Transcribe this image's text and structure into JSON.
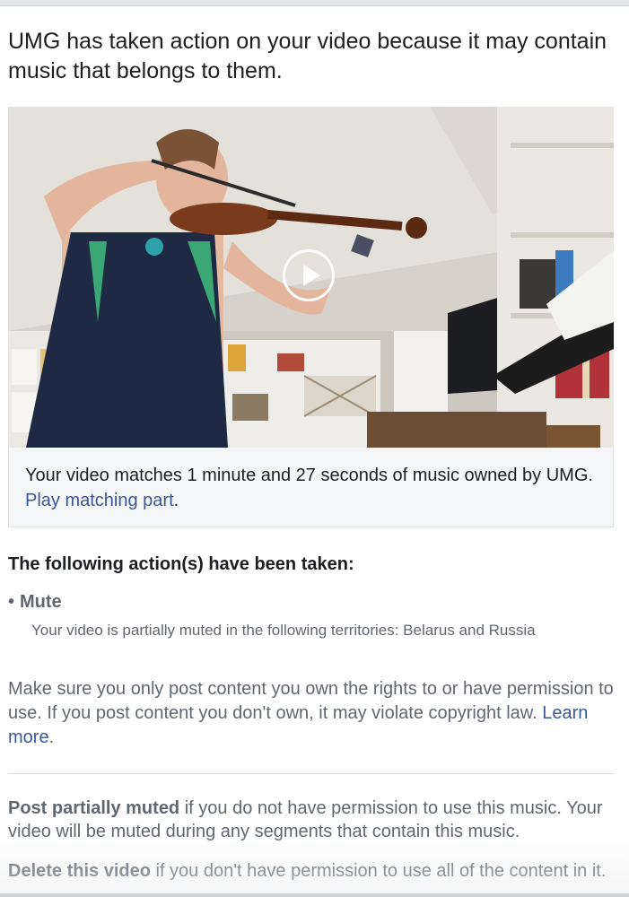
{
  "notice": {
    "title": "UMG has taken action on your video because it may contain music that belongs to them."
  },
  "video": {
    "play_icon": "play-icon",
    "thumbnail": "person-playing-violin-in-room"
  },
  "match": {
    "text": "Your video matches 1 minute and 27 seconds of music owned by UMG.",
    "link_label": "Play matching part",
    "suffix": "."
  },
  "actions": {
    "heading": "The following action(s) have been taken:",
    "items": [
      {
        "bullet": "•",
        "label": "Mute",
        "description": "Your video is partially muted in the following territories: Belarus and Russia"
      }
    ]
  },
  "rights": {
    "text": "Make sure you only post content you own the rights to or have permission to use. If you post content you don't own, it may violate copyright law.",
    "link_label": "Learn more",
    "suffix": "."
  },
  "options": [
    {
      "title": "Post partially muted",
      "text": " if you do not have permission to use this music. Your video will be muted during any segments that contain this music."
    },
    {
      "title": "Delete this video",
      "text": " if you don't have permission to use all of the content in it."
    }
  ],
  "colors": {
    "link": "#385898",
    "muted_text": "#606770",
    "primary_text": "#1c1e21",
    "box_bg": "#f5f6f7"
  }
}
